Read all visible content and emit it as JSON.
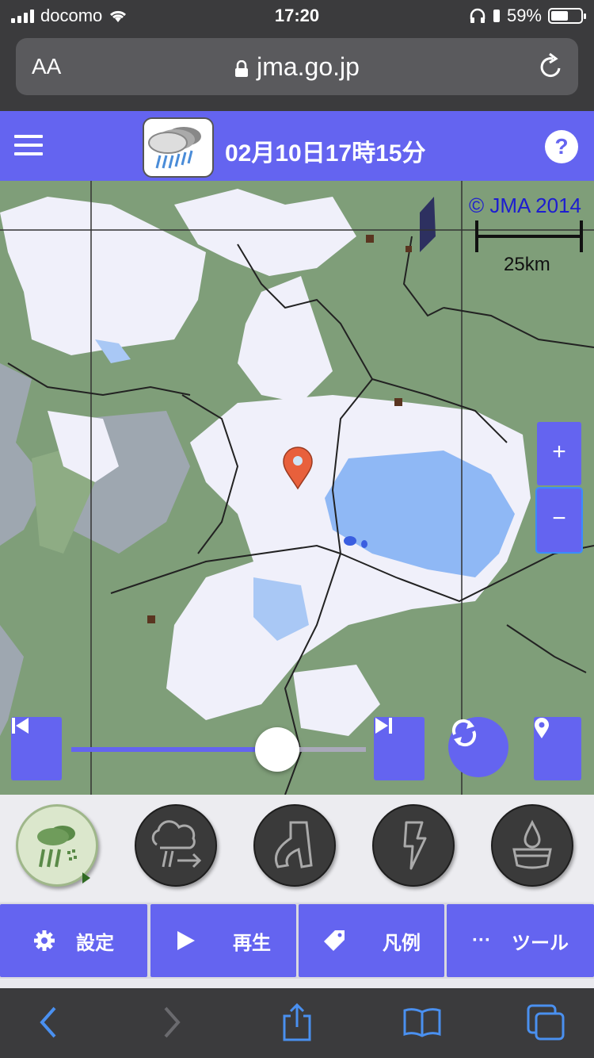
{
  "status_bar": {
    "carrier": "docomo",
    "time": "17:20",
    "battery_percent": "59%",
    "battery_level": 0.59
  },
  "address_bar": {
    "text_size_label": "AA",
    "url": "jma.go.jp"
  },
  "header": {
    "title": "02月10日17時15分",
    "help_label": "?"
  },
  "map": {
    "copyright": "© JMA 2014",
    "scale_label": "25km",
    "zoom_in_label": "+",
    "zoom_out_label": "−"
  },
  "timeline": {
    "position": 0.7
  },
  "layers": [
    {
      "name": "雨雲",
      "icon": "rain-cloud-icon",
      "active": true
    },
    {
      "name": "雨雲の動き",
      "icon": "cloud-movement-icon",
      "active": false
    },
    {
      "name": "竜巻",
      "icon": "tornado-icon",
      "active": false
    },
    {
      "name": "雷",
      "icon": "lightning-icon",
      "active": false
    },
    {
      "name": "降水",
      "icon": "drop-bowl-icon",
      "active": false
    }
  ],
  "menu": {
    "settings": "設定",
    "play": "再生",
    "legend": "凡例",
    "tools": "ツール",
    "tools_prefix": "···"
  },
  "colors": {
    "accent": "#6464f0",
    "map_land": "#7f9e79",
    "snow_rain_light": "#f0f0fa",
    "rain_blue": "#8fb8f5",
    "marker": "#e8603c"
  }
}
